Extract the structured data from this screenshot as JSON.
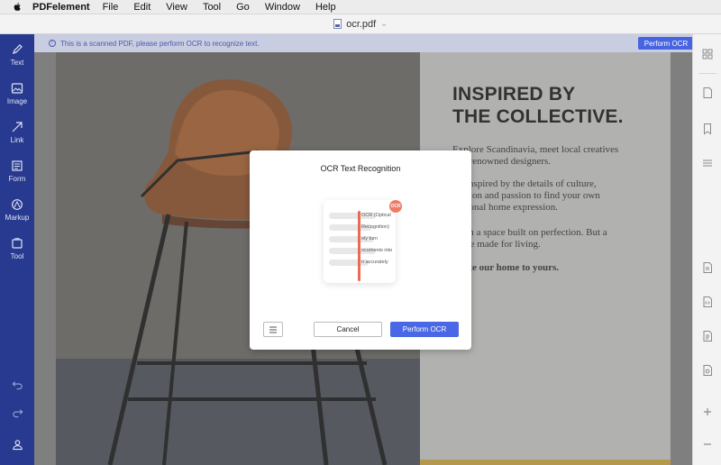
{
  "menubar": {
    "app_name": "PDFelement",
    "items": [
      "File",
      "Edit",
      "View",
      "Tool",
      "Go",
      "Window",
      "Help"
    ]
  },
  "titlebar": {
    "filename": "ocr.pdf"
  },
  "left_toolbar": {
    "tools": [
      {
        "label": "Text",
        "icon": "pen-icon"
      },
      {
        "label": "Image",
        "icon": "image-icon"
      },
      {
        "label": "Link",
        "icon": "link-icon"
      },
      {
        "label": "Form",
        "icon": "form-icon"
      },
      {
        "label": "Markup",
        "icon": "markup-icon"
      },
      {
        "label": "Tool",
        "icon": "tool-icon"
      }
    ]
  },
  "info_strip": {
    "message": "This is a scanned PDF, please perform OCR to recognize text.",
    "button_label": "Perform OCR"
  },
  "document": {
    "heading_line1": "INSPIRED BY",
    "heading_line2": "THE COLLECTIVE.",
    "para1_l1": "Explore Scandinavia, meet local creatives",
    "para1_l2": "and renowned designers.",
    "para2_l1": "Be inspired by the details of culture,",
    "para2_l2": "passion and passion to find your own",
    "para2_l3": "personal home expression.",
    "para3_l1": "From a space built on perfection. But a",
    "para3_l2": "home made for living.",
    "para4": "Make our home to yours."
  },
  "modal": {
    "title": "OCR Text Recognition",
    "badge": "OCR",
    "illustration_lines": [
      "OCR (Optical",
      "Recognition)",
      "ely turn",
      "ocuments into",
      "n accurately"
    ],
    "cancel_label": "Cancel",
    "confirm_label": "Perform OCR"
  },
  "colors": {
    "accent": "#4a67e5",
    "left_toolbar": "#283a8f",
    "ocr_badge": "#ef7a67"
  }
}
